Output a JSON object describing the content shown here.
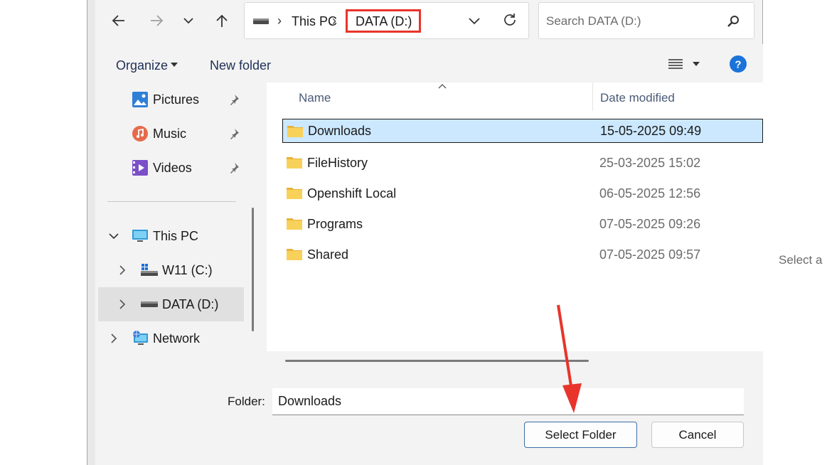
{
  "toolbar": {
    "back_icon": "arrow-left-icon",
    "forward_icon": "arrow-right-icon",
    "recent_icon": "chevron-down-icon",
    "up_icon": "arrow-up-icon"
  },
  "address": {
    "drive_icon": "drive-icon",
    "crumbs": [
      "This PC",
      "DATA (D:)"
    ],
    "highlight_color": "#e8342b"
  },
  "search": {
    "placeholder": "Search DATA (D:)",
    "icon": "search-icon"
  },
  "commands": {
    "organize": "Organize",
    "new_folder": "New folder",
    "view_icon": "list-view-icon",
    "help_icon": "help-icon"
  },
  "nav": {
    "quick_items": [
      {
        "label": "Pictures",
        "icon": "pictures-icon",
        "pinned": true
      },
      {
        "label": "Music",
        "icon": "music-icon",
        "pinned": true
      },
      {
        "label": "Videos",
        "icon": "videos-icon",
        "pinned": true
      }
    ],
    "this_pc": "This PC",
    "drives": [
      {
        "label": "W11 (C:)",
        "icon": "windows-drive-icon"
      },
      {
        "label": "DATA (D:)",
        "icon": "drive-icon",
        "selected": true
      }
    ],
    "network": "Network"
  },
  "list": {
    "headers": {
      "name": "Name",
      "date": "Date modified"
    },
    "rows": [
      {
        "name": "Downloads",
        "date": "15-05-2025 09:49",
        "selected": true
      },
      {
        "name": "FileHistory",
        "date": "25-03-2025 15:02"
      },
      {
        "name": "Openshift Local",
        "date": "06-05-2025 12:56"
      },
      {
        "name": "Programs",
        "date": "07-05-2025 09:26"
      },
      {
        "name": "Shared",
        "date": "07-05-2025 09:57"
      }
    ]
  },
  "footer": {
    "folder_label": "Folder:",
    "folder_value": "Downloads",
    "select_button": "Select Folder",
    "cancel_button": "Cancel"
  },
  "background": {
    "right_text": "Select a"
  },
  "colors": {
    "selection": "#cce8ff",
    "arrow": "#e8342b",
    "help": "#1a73d9"
  }
}
